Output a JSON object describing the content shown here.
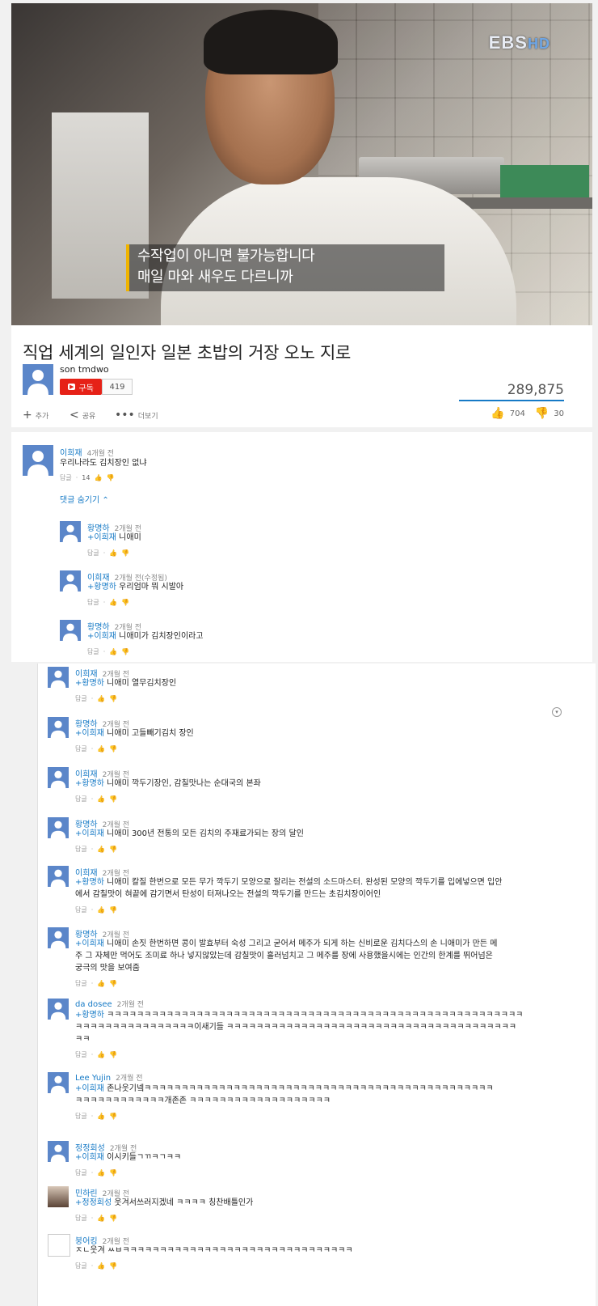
{
  "video": {
    "logo_main": "EBS",
    "logo_hd": "HD",
    "subtitle_line1": "수작업이 아니면 불가능합니다",
    "subtitle_line2": "매일 마와 새우도 다르니까"
  },
  "info": {
    "title": "직업 세계의 일인자 일본 초밥의 거장 오노 지로",
    "channel": "son tmdwo",
    "subscribe_label": "구독",
    "subscriber_count": "419",
    "views": "289,875",
    "add_label": "추가",
    "share_label": "공유",
    "more_label": "더보기",
    "like_count": "704",
    "dislike_count": "30"
  },
  "colors": {
    "accent": "#167ac6",
    "subscribe": "#e62117",
    "avatar": "#5b86c9"
  },
  "top_comment": {
    "name": "이희재",
    "time": "4개월 전",
    "text": "우리나라도 김치장인 없냐",
    "reply_label": "답글",
    "like_count": "14",
    "hide_replies": "댓글 숨기기 ⌃"
  },
  "replies_a": [
    {
      "name": "황명하",
      "time": "2개월 전",
      "mention": "+이희재",
      "text": " 니애미"
    },
    {
      "name": "이희재",
      "time": "2개월 전(수정됨)",
      "mention": "+황명하",
      "text": " 우리엄마 뭐 시발아"
    },
    {
      "name": "황명하",
      "time": "2개월 전",
      "mention": "+이희재",
      "text": " 니애미가 김치장인이라고"
    }
  ],
  "replies_b": [
    {
      "name": "이희재",
      "time": "2개월 전",
      "mention": "+황명하",
      "lines": [
        " 니애미 열무김치장인"
      ]
    },
    {
      "name": "황명하",
      "time": "2개월 전",
      "mention": "+이희재",
      "lines": [
        " 니애미 고들빼기김치 장인"
      ]
    },
    {
      "name": "이희재",
      "time": "2개월 전",
      "mention": "+황명하",
      "lines": [
        " 니애미 깍두기장인, 감칠맛나는 순대국의 본좌"
      ]
    },
    {
      "name": "황명하",
      "time": "2개월 전",
      "mention": "+이희재",
      "lines": [
        " 니애미 300년 전통의 모든 김치의 주재료가되는 장의 달인"
      ]
    },
    {
      "name": "이희재",
      "time": "2개월 전",
      "mention": "+황명하",
      "lines": [
        " 니애미 칼질 한번으로 모든 무가 깍두기 모양으로 잘리는 전설의 소드마스터. 완성된 모양의 깍두기를 입에넣으면 입안",
        "에서 감칠맛이 혀끝에 감기면서 탄성이 터져나오는 전설의 깍두기를 만드는  초김치장이어인"
      ]
    },
    {
      "name": "황명하",
      "time": "2개월 전",
      "mention": "+이희재",
      "lines": [
        " 니애미 손짓 한번하면 콩이 발효부터 숙성 그리고 굳어서 메주가 되게 하는 신비로운 김치다스의 손 니애미가 만든 메",
        "주 그 자체만 먹어도 조미료 하나 넣지않았는데 감칠맛이 흘러넘치고 그 메주를 장에 사용했을시에는 인간의 한계를 뛰어넘은",
        "궁극의 맛을 보여줌"
      ]
    },
    {
      "name": "da dosee",
      "time": "2개월 전",
      "mention": "+황명하",
      "lines": [
        " ㅋㅋㅋㅋㅋㅋㅋㅋㅋㅋㅋㅋㅋㅋㅋㅋㅋㅋㅋㅋㅋㅋㅋㅋㅋㅋㅋㅋㅋㅋㅋㅋㅋㅋㅋㅋㅋㅋㅋㅋㅋㅋㅋㅋㅋㅋㅋㅋㅋㅋㅋㅋㅋㅋㅋㅋ",
        "ㅋㅋㅋㅋㅋㅋㅋㅋㅋㅋㅋㅋㅋㅋㅋㅋ이새기들 ㅋㅋㅋㅋㅋㅋㅋㅋㅋㅋㅋㅋㅋㅋㅋㅋㅋㅋㅋㅋㅋㅋㅋㅋㅋㅋㅋㅋㅋㅋㅋㅋㅋㅋㅋㅋㅋㅋㅋ",
        "ㅋㅋ"
      ]
    },
    {
      "name": "Lee Yujin",
      "time": "2개월 전",
      "mention": "+이희재",
      "lines": [
        " 존나웃기넼ㅋㅋㅋㅋㅋㅋㅋㅋㅋㅋㅋㅋㅋㅋㅋㅋㅋㅋㅋㅋㅋㅋㅋㅋㅋㅋㅋㅋㅋㅋㅋㅋㅋㅋㅋㅋㅋㅋㅋㅋㅋㅋㅋㅋㅋㅋㅋ",
        "ㅋㅋㅋㅋㅋㅋㅋㅋㅋㅋㅋㅋ개존존 ㅋㅋㅋㅋㅋㅋㅋㅋㅋㅋㅋㅋㅋㅋㅋㅋㅋㅋㅋ"
      ]
    },
    {
      "name": "정정회성",
      "time": "2개월 전",
      "mention": "+이희재",
      "lines": [
        " 이시키들ㄱㄲㅋㄱㅋㅋ"
      ]
    },
    {
      "name": "민하린",
      "time": "2개월 전",
      "mention": "+정정회성",
      "lines": [
        " 웃겨서쓰러지겠네 ㅋㅋㅋㅋ 칭찬배틀인가"
      ]
    },
    {
      "name": "붕어킹",
      "time": "2개월 전",
      "mention": "",
      "lines": [
        "ㅈㄴ웃겨 ㅆㅂㅋㅋㅋㅋㅋㅋㅋㅋㅋㅋㅋㅋㅋㅋㅋㅋㅋㅋㅋㅋㅋㅋㅋㅋㅋㅋㅋㅋㅋㅋㅋ"
      ]
    }
  ],
  "reply_label": "답글"
}
